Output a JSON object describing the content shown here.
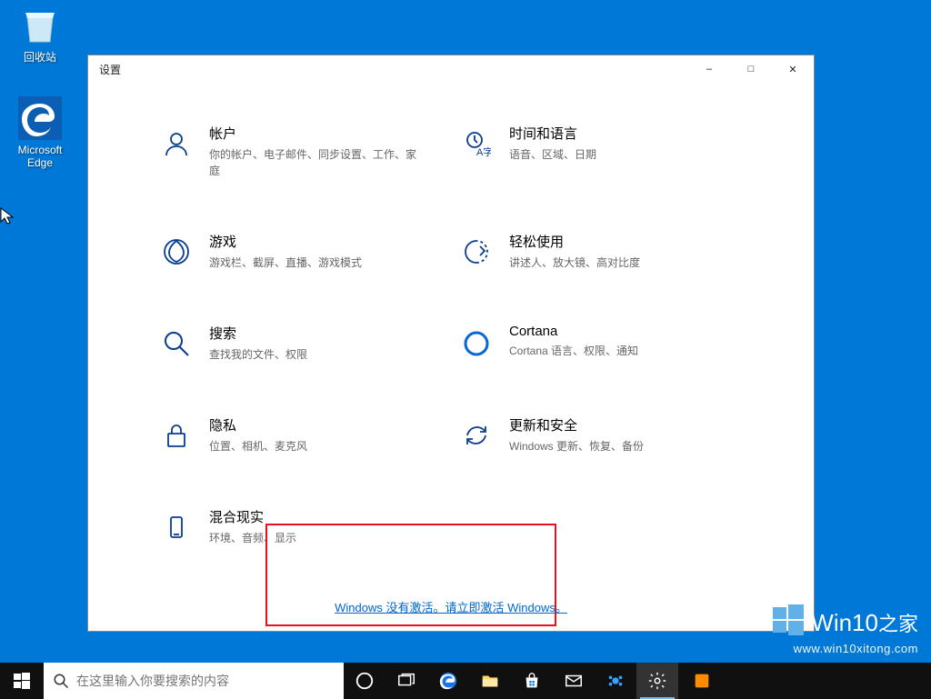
{
  "desktop": {
    "recycle_bin": "回收站",
    "edge": "Microsoft\nEdge"
  },
  "window": {
    "title": "设置"
  },
  "categories": [
    {
      "icon": "accounts",
      "title": "帐户",
      "desc": "你的帐户、电子邮件、同步设置、工作、家庭"
    },
    {
      "icon": "time",
      "title": "时间和语言",
      "desc": "语音、区域、日期"
    },
    {
      "icon": "gaming",
      "title": "游戏",
      "desc": "游戏栏、截屏、直播、游戏模式"
    },
    {
      "icon": "ease",
      "title": "轻松使用",
      "desc": "讲述人、放大镜、高对比度"
    },
    {
      "icon": "search",
      "title": "搜索",
      "desc": "查找我的文件、权限"
    },
    {
      "icon": "cortana",
      "title": "Cortana",
      "desc": "Cortana 语言、权限、通知"
    },
    {
      "icon": "privacy",
      "title": "隐私",
      "desc": "位置、相机、麦克风"
    },
    {
      "icon": "update",
      "title": "更新和安全",
      "desc": "Windows 更新、恢复、备份"
    },
    {
      "icon": "mr",
      "title": "混合现实",
      "desc": "环境、音频、显示"
    }
  ],
  "activation_text": "Windows 没有激活。请立即激活 Windows。",
  "taskbar": {
    "search_placeholder": "在这里输入你要搜索的内容"
  },
  "watermark": {
    "title_en": "Win10",
    "title_zh": "之家",
    "url": "www.win10xitong.com"
  }
}
